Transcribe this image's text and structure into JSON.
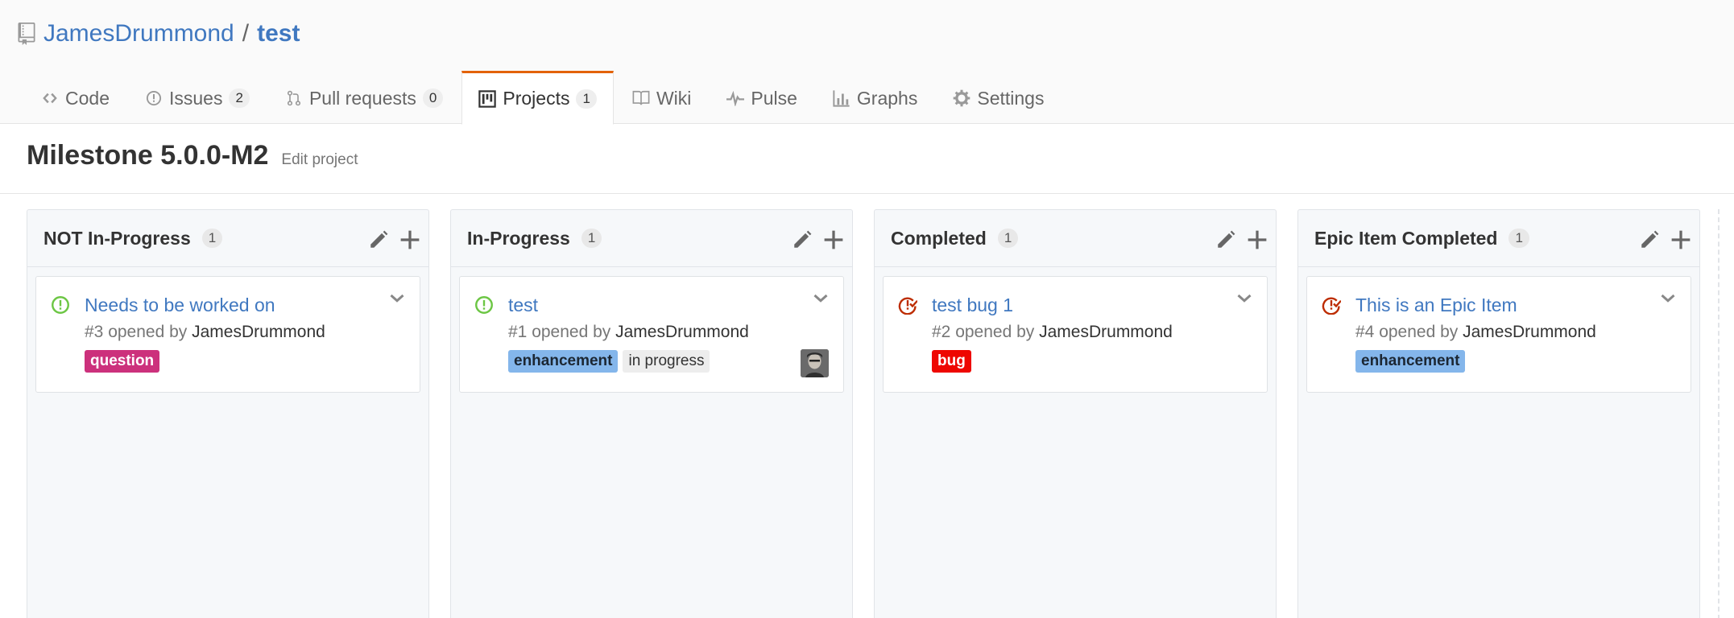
{
  "repo": {
    "owner": "JamesDrummond",
    "separator": "/",
    "name": "test"
  },
  "tabs": [
    {
      "label": "Code",
      "icon": "code-icon",
      "counter": null,
      "selected": false
    },
    {
      "label": "Issues",
      "icon": "issue-opened-icon",
      "counter": "2",
      "selected": false
    },
    {
      "label": "Pull requests",
      "icon": "git-pull-request-icon",
      "counter": "0",
      "selected": false
    },
    {
      "label": "Projects",
      "icon": "project-icon",
      "counter": "1",
      "selected": true
    },
    {
      "label": "Wiki",
      "icon": "book-icon",
      "counter": null,
      "selected": false
    },
    {
      "label": "Pulse",
      "icon": "pulse-icon",
      "counter": null,
      "selected": false
    },
    {
      "label": "Graphs",
      "icon": "graph-icon",
      "counter": null,
      "selected": false
    },
    {
      "label": "Settings",
      "icon": "gear-icon",
      "counter": null,
      "selected": false
    }
  ],
  "project": {
    "title": "Milestone 5.0.0-M2",
    "edit_label": "Edit project"
  },
  "columns": [
    {
      "name": "NOT In-Progress",
      "count": "1",
      "card": {
        "title": "Needs to be worked on",
        "status": "open",
        "meta_prefix": "#3 opened by",
        "author": "JamesDrummond",
        "labels": [
          {
            "text": "question",
            "bg": "#cc317c",
            "fg": "#ffffff"
          }
        ],
        "avatar": false
      }
    },
    {
      "name": "In-Progress",
      "count": "1",
      "card": {
        "title": "test",
        "status": "open",
        "meta_prefix": "#1 opened by",
        "author": "JamesDrummond",
        "labels": [
          {
            "text": "enhancement",
            "bg": "#84b6eb",
            "fg": "#1c2733"
          },
          {
            "text": "in progress",
            "bg": "#ededed",
            "fg": "#333333"
          }
        ],
        "avatar": true
      }
    },
    {
      "name": "Completed",
      "count": "1",
      "card": {
        "title": "test bug 1",
        "status": "closed",
        "meta_prefix": "#2 opened by",
        "author": "JamesDrummond",
        "labels": [
          {
            "text": "bug",
            "bg": "#ee0701",
            "fg": "#ffffff"
          }
        ],
        "avatar": false
      }
    },
    {
      "name": "Epic Item Completed",
      "count": "1",
      "card": {
        "title": "This is an Epic Item",
        "status": "closed",
        "meta_prefix": "#4 opened by",
        "author": "JamesDrummond",
        "labels": [
          {
            "text": "enhancement",
            "bg": "#84b6eb",
            "fg": "#1c2733"
          }
        ],
        "avatar": false
      }
    }
  ],
  "colors": {
    "link": "#4078c0",
    "open": "#6cc644",
    "closed": "#bd2c00",
    "tab_accent": "#e36209"
  }
}
